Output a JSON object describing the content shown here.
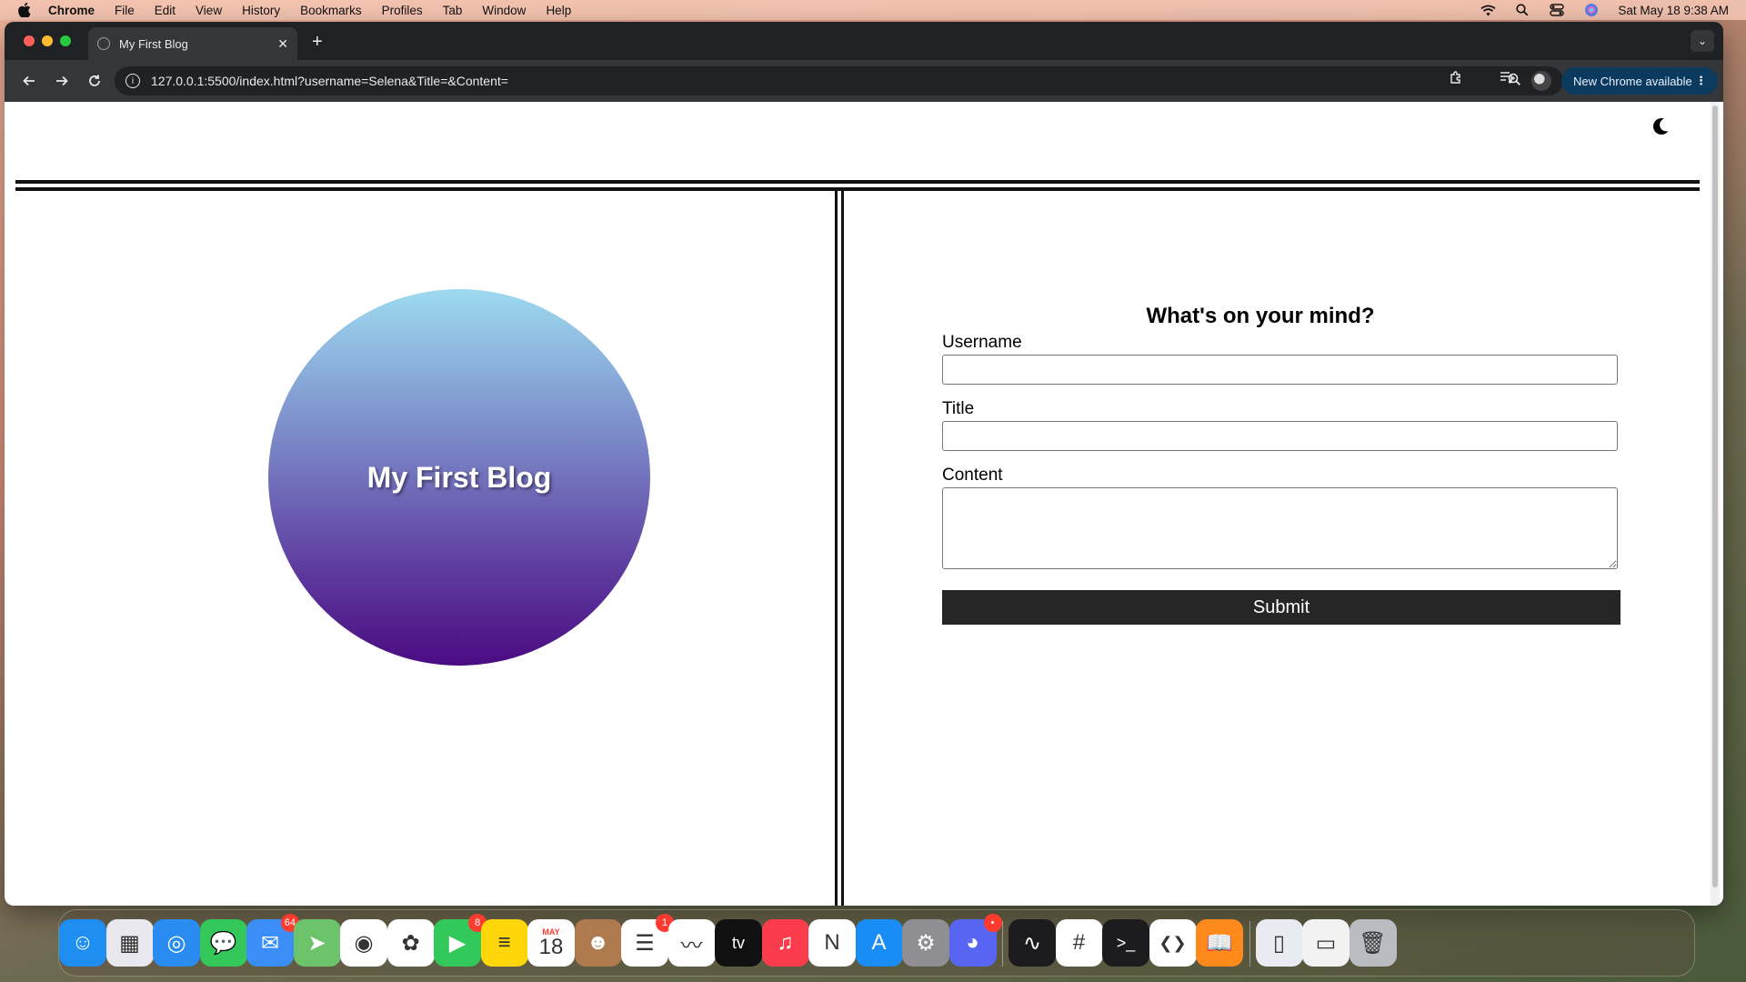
{
  "menubar": {
    "app_name": "Chrome",
    "items": [
      "File",
      "Edit",
      "View",
      "History",
      "Bookmarks",
      "Profiles",
      "Tab",
      "Window",
      "Help"
    ],
    "datetime": "Sat May 18  9:38 AM"
  },
  "browser": {
    "tab_title": "My First Blog",
    "url": "127.0.0.1:5500/index.html?username=Selena&Title=&Content=",
    "update_label": "New Chrome available"
  },
  "page": {
    "hero_title": "My First Blog",
    "form": {
      "heading": "What's on your mind?",
      "username_label": "Username",
      "username_value": "",
      "title_label": "Title",
      "title_value": "",
      "content_label": "Content",
      "content_value": "",
      "submit_label": "Submit"
    }
  },
  "dock": {
    "apps": [
      {
        "name": "Finder",
        "icon": "finder-icon",
        "color": "#1f8ef1"
      },
      {
        "name": "Launchpad",
        "icon": "launchpad-icon",
        "color": "#e8e8ee"
      },
      {
        "name": "Safari",
        "icon": "safari-icon",
        "color": "#2a8cf0"
      },
      {
        "name": "Messages",
        "icon": "messages-icon",
        "color": "#34c759"
      },
      {
        "name": "Mail",
        "icon": "mail-icon",
        "color": "#3a8ef6",
        "badge": "64"
      },
      {
        "name": "Maps",
        "icon": "maps-icon",
        "color": "#6cc36a"
      },
      {
        "name": "Chrome",
        "icon": "chrome-icon",
        "color": "#ffffff"
      },
      {
        "name": "Photos",
        "icon": "photos-icon",
        "color": "#ffffff"
      },
      {
        "name": "FaceTime",
        "icon": "facetime-icon",
        "color": "#32c85a",
        "badge": "8"
      },
      {
        "name": "Notes",
        "icon": "notes-icon",
        "color": "#ffd60a"
      },
      {
        "name": "Calendar",
        "icon": "calendar-icon",
        "color": "#ffffff",
        "month": "MAY",
        "day": "18"
      },
      {
        "name": "Contacts",
        "icon": "contacts-icon",
        "color": "#b07a4f"
      },
      {
        "name": "Reminders",
        "icon": "reminders-icon",
        "color": "#ffffff",
        "badge": "1"
      },
      {
        "name": "Freeform",
        "icon": "freeform-icon",
        "color": "#ffffff"
      },
      {
        "name": "TV",
        "icon": "tv-icon",
        "color": "#111111"
      },
      {
        "name": "Music",
        "icon": "music-icon",
        "color": "#fa3c4c"
      },
      {
        "name": "News",
        "icon": "news-icon",
        "color": "#ffffff"
      },
      {
        "name": "App Store",
        "icon": "appstore-icon",
        "color": "#1a8cf5"
      },
      {
        "name": "System Settings",
        "icon": "settings-icon",
        "color": "#8e8e93"
      },
      {
        "name": "Discord",
        "icon": "discord-icon",
        "color": "#5865f2",
        "badge": "•"
      },
      {
        "name": "Activity Monitor",
        "icon": "activity-monitor-icon",
        "color": "#1c1c1e"
      },
      {
        "name": "Slack",
        "icon": "slack-icon",
        "color": "#ffffff"
      },
      {
        "name": "Terminal",
        "icon": "terminal-icon",
        "color": "#1c1c1e"
      },
      {
        "name": "VS Code",
        "icon": "vscode-icon",
        "color": "#ffffff"
      },
      {
        "name": "Books",
        "icon": "books-icon",
        "color": "#ff8a1c"
      },
      {
        "name": "Document",
        "icon": "document-icon",
        "color": "#e8ecf2"
      },
      {
        "name": "Preview",
        "icon": "preview-icon",
        "color": "#f2f2f2"
      },
      {
        "name": "Trash",
        "icon": "trash-icon",
        "color": "#b9bcc0"
      }
    ]
  },
  "colors": {
    "submit_bg": "#262626",
    "update_btn_bg": "#0b3a5e",
    "hero_gradient_top": "#9ddaf0",
    "hero_gradient_bottom": "#4b0c82"
  }
}
